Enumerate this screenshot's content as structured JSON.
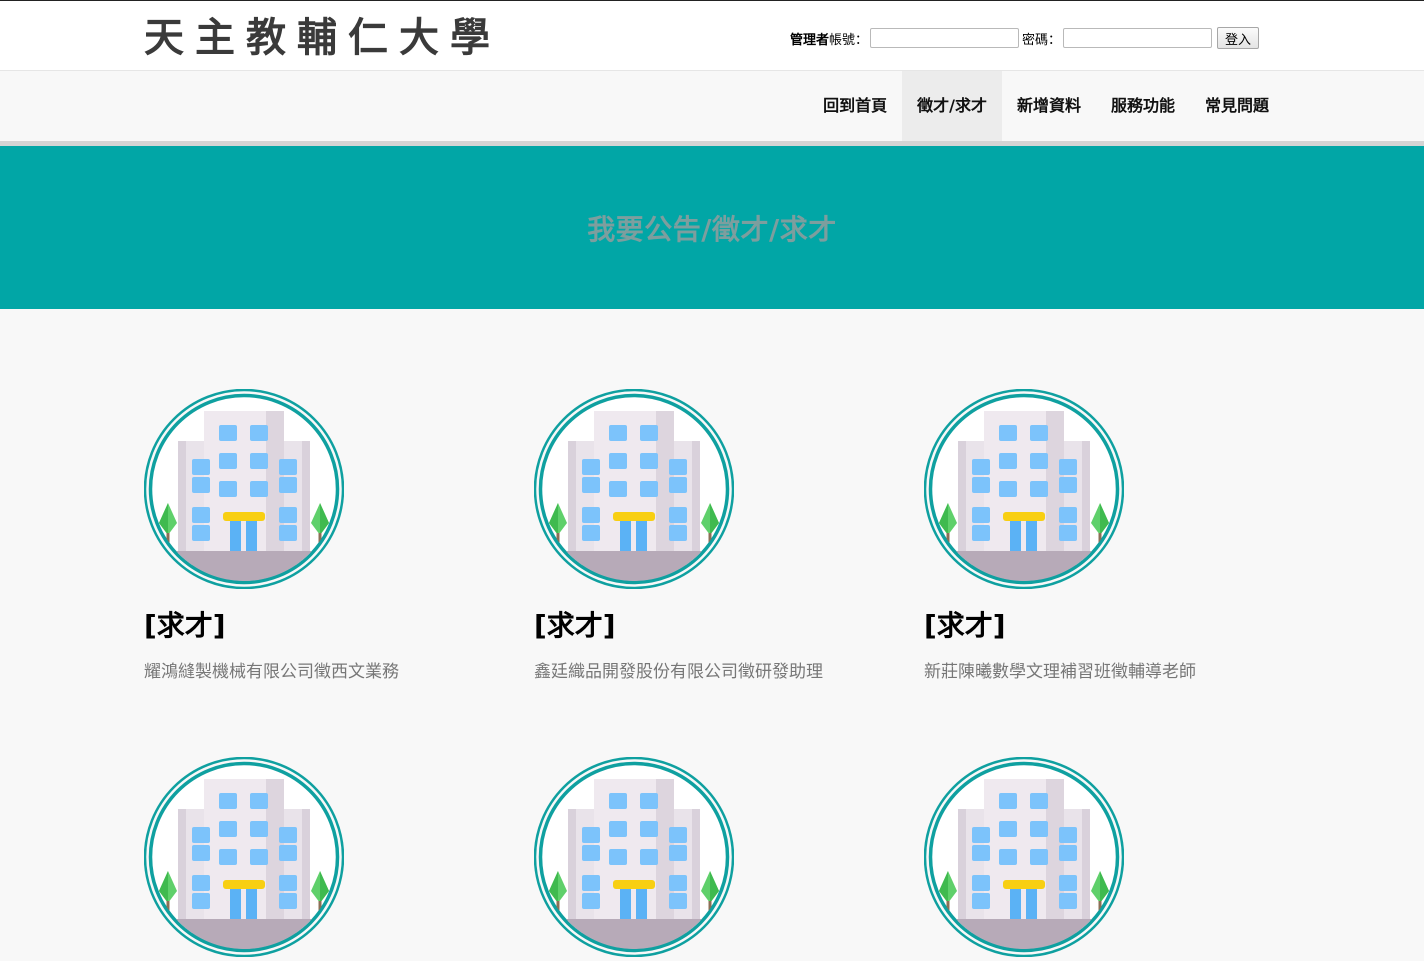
{
  "header": {
    "logo_text": "天主教輔仁大學",
    "admin_label": "管理者",
    "account_label": "帳號：",
    "password_label": "密碼：",
    "login_button": "登入"
  },
  "nav": {
    "items": [
      {
        "label": "回到首頁",
        "active": false
      },
      {
        "label": "徵才/求才",
        "active": true
      },
      {
        "label": "新增資料",
        "active": false
      },
      {
        "label": "服務功能",
        "active": false
      },
      {
        "label": "常見問題",
        "active": false
      }
    ]
  },
  "hero": {
    "title": "我要公告/徵才/求才"
  },
  "cards": [
    {
      "tag": "[求才]",
      "description": "耀鴻縫製機械有限公司徵西文業務",
      "icon": "building-icon"
    },
    {
      "tag": "[求才]",
      "description": "鑫廷織品開發股份有限公司徵研發助理",
      "icon": "building-icon"
    },
    {
      "tag": "[求才]",
      "description": "新莊陳曦數學文理補習班徵輔導老師",
      "icon": "building-icon"
    },
    {
      "tag": "",
      "description": "",
      "icon": "building-icon"
    },
    {
      "tag": "",
      "description": "",
      "icon": "building-icon"
    },
    {
      "tag": "",
      "description": "",
      "icon": "building-icon"
    }
  ],
  "colors": {
    "hero_bg": "#01a6a6",
    "ring": "#0fa0a0",
    "hero_title": "#7d9e9e",
    "nav_active_bg": "#ececec"
  }
}
